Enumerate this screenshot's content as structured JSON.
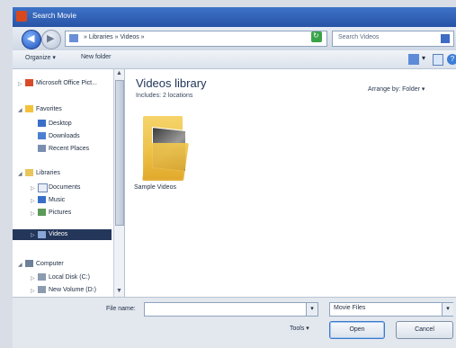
{
  "window": {
    "title": "Search Movie"
  },
  "address": {
    "breadcrumb": "» Libraries » Videos »",
    "search_placeholder": "Search Videos"
  },
  "toolbar": {
    "organize": "Organize ▾",
    "new_folder": "New folder"
  },
  "sidebar": {
    "items": [
      {
        "label": "Microsoft Office Pict..."
      },
      {
        "label": "Favorites"
      },
      {
        "label": "Desktop"
      },
      {
        "label": "Downloads"
      },
      {
        "label": "Recent Places"
      },
      {
        "label": "Libraries"
      },
      {
        "label": "Documents"
      },
      {
        "label": "Music"
      },
      {
        "label": "Pictures"
      },
      {
        "label": "Videos"
      },
      {
        "label": "Computer"
      },
      {
        "label": "Local Disk (C:)"
      },
      {
        "label": "New Volume (D:)"
      }
    ]
  },
  "main": {
    "title": "Videos library",
    "subtitle": "Includes: 2 locations",
    "arrange_by": "Arrange by:   Folder  ▾",
    "items": [
      {
        "label": "Sample Videos"
      }
    ]
  },
  "footer": {
    "filename_label": "File name:",
    "filename_value": "",
    "filter": "Movie Files",
    "tools": "Tools   ▾",
    "open": "Open",
    "cancel": "Cancel"
  },
  "colors": {
    "titlebar": "#2f63ba",
    "selected": "#24365a",
    "folder": "#f2c84e"
  }
}
